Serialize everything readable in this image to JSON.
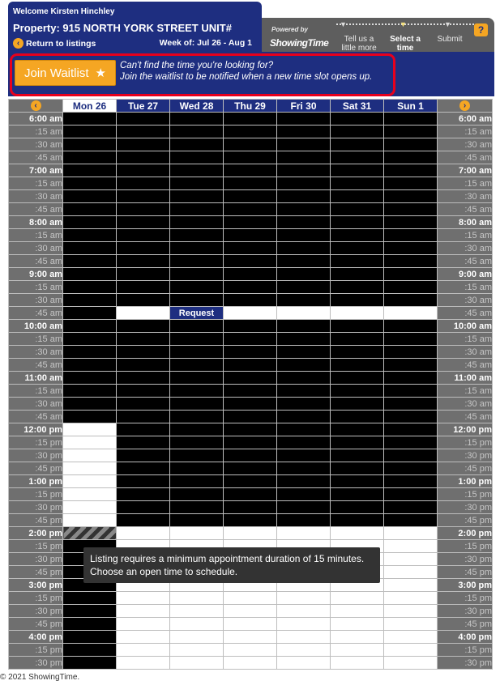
{
  "header": {
    "welcome": "Welcome Kirsten Hinchley",
    "property": "Property: 915 NORTH YORK STREET UNIT#",
    "return_label": "Return to listings",
    "week": "Week of: Jul 26 - Aug 1"
  },
  "wizard": {
    "powered_by": "Powered by",
    "brand": "ShowingTime",
    "steps": [
      "Tell us a little more",
      "Select a time",
      "Submit"
    ],
    "help": "?"
  },
  "waitlist": {
    "button_label": "Join Waitlist",
    "line1": "Can't find the time you're looking for?",
    "line2": "Join the waitlist to be notified when a new time slot opens up."
  },
  "calendar": {
    "days": [
      "Mon 26",
      "Tue 27",
      "Wed 28",
      "Thu 29",
      "Fri 30",
      "Sat 31",
      "Sun 1"
    ],
    "request_label": "Request",
    "times": [
      "6:00 am",
      ":15 am",
      ":30 am",
      ":45 am",
      "7:00 am",
      ":15 am",
      ":30 am",
      ":45 am",
      "8:00 am",
      ":15 am",
      ":30 am",
      ":45 am",
      "9:00 am",
      ":15 am",
      ":30 am",
      ":45 am",
      "10:00 am",
      ":15 am",
      ":30 am",
      ":45 am",
      "11:00 am",
      ":15 am",
      ":30 am",
      ":45 am",
      "12:00 pm",
      ":15 pm",
      ":30 pm",
      ":45 pm",
      "1:00 pm",
      ":15 pm",
      ":30 pm",
      ":45 pm",
      "2:00 pm",
      ":15 pm",
      ":30 pm",
      ":45 pm",
      "3:00 pm",
      ":15 pm",
      ":30 pm",
      ":45 pm",
      "4:00 pm",
      ":15 pm",
      ":30 pm"
    ]
  },
  "tooltip": {
    "line1": "Listing requires a minimum appointment duration of 15 minutes.",
    "line2": "Choose an open time to schedule."
  },
  "footer": "© 2021 ShowingTime.",
  "colors": {
    "navy": "#1e2e80",
    "accent": "#f5a623",
    "highlight": "#e8001c"
  }
}
